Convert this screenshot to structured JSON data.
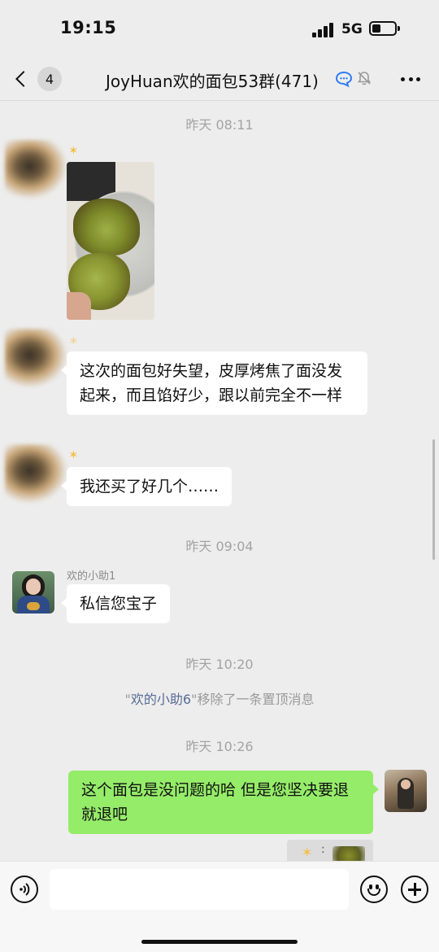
{
  "status_bar": {
    "time": "19:15",
    "network": "5G",
    "battery_level": 0.4
  },
  "nav": {
    "unread_count": "4",
    "title": "JoyHuan欢的面包53群(471)",
    "icons": [
      "back-chevron-icon",
      "chat-bubble-icon",
      "mute-bell-icon",
      "more-icon"
    ]
  },
  "messages": {
    "time_1": "昨天 08:11",
    "msg_1_text": "这次的面包好失望，皮厚烤焦了面没发起来，而且馅好少，跟以前完全不一样",
    "msg_2_text": "我还买了好几个……",
    "time_2": "昨天 09:04",
    "helper_sender": "欢的小助1",
    "helper_text": "私信您宝子",
    "time_3": "昨天 10:20",
    "sys_quote_open": "\"",
    "sys_name": "欢的小助6",
    "sys_text": "\"移除了一条置顶消息",
    "time_4": "昨天 10:26",
    "my_text": "这个面包是没问题的哈 但是您坚决要退就退吧",
    "quote_colon": ":"
  },
  "input": {
    "placeholder": ""
  },
  "colors": {
    "my_bubble": "#95ec69",
    "other_bubble": "#ffffff",
    "background": "#ededed",
    "link_name": "#576b95"
  }
}
